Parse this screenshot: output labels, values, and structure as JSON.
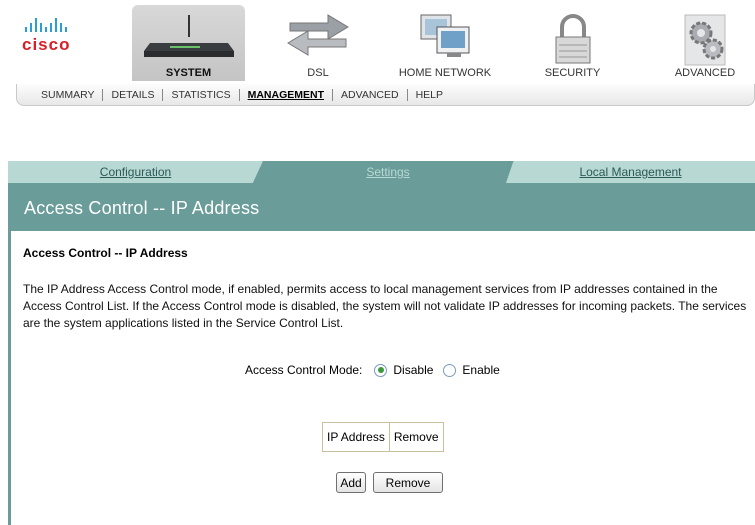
{
  "brand": {
    "name": "cisco",
    "accent": "#d61f26",
    "bars_color": "#2a9fd6"
  },
  "nav": {
    "items": [
      {
        "label": "SYSTEM",
        "icon": "router-icon",
        "active": true
      },
      {
        "label": "DSL",
        "icon": "arrows-exchange-icon"
      },
      {
        "label": "HOME NETWORK",
        "icon": "computers-icon"
      },
      {
        "label": "SECURITY",
        "icon": "padlock-icon"
      },
      {
        "label": "ADVANCED",
        "icon": "gears-icon"
      }
    ]
  },
  "subnav": {
    "items": [
      "SUMMARY",
      "DETAILS",
      "STATISTICS",
      "MANAGEMENT",
      "ADVANCED",
      "HELP"
    ],
    "active": "MANAGEMENT"
  },
  "tabs": {
    "items": [
      "Configuration",
      "Settings",
      "Local Management"
    ],
    "active": "Settings"
  },
  "header": {
    "title": "Access Control -- IP Address"
  },
  "section": {
    "title": "Access Control -- IP Address",
    "description": "The IP Address Access Control mode, if enabled, permits access to local management services from IP addresses contained in the Access Control List. If the Access Control mode is disabled, the system will not validate IP addresses for incoming packets. The services are the system applications listed in the Service Control List."
  },
  "mode": {
    "label": "Access Control Mode:",
    "options": [
      "Disable",
      "Enable"
    ],
    "selected": "Disable"
  },
  "ip_table": {
    "columns": [
      "IP Address",
      "Remove"
    ]
  },
  "buttons": {
    "add": "Add",
    "remove": "Remove"
  },
  "colors": {
    "teal": "#6a9c99",
    "tab_light": "#b8d8d3"
  }
}
